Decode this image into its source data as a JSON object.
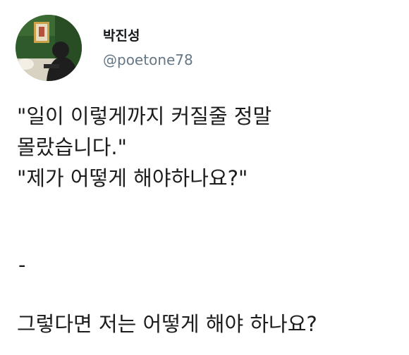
{
  "profile": {
    "display_name": "박진성",
    "handle": "@poetone78",
    "avatar_colors": {
      "background": "#2f5a2c",
      "frame": "#c9a24b",
      "person": "#1e1e1e",
      "light": "#e8e2d0"
    }
  },
  "tweet": {
    "lines": [
      "\"일이 이렇게까지 커질줄 정말",
      "몰랐습니다.\"",
      "\"제가 어떻게 해야하나요?\""
    ],
    "separator": "-",
    "reply": "그렇다면 저는 어떻게 해야 하나요?"
  }
}
